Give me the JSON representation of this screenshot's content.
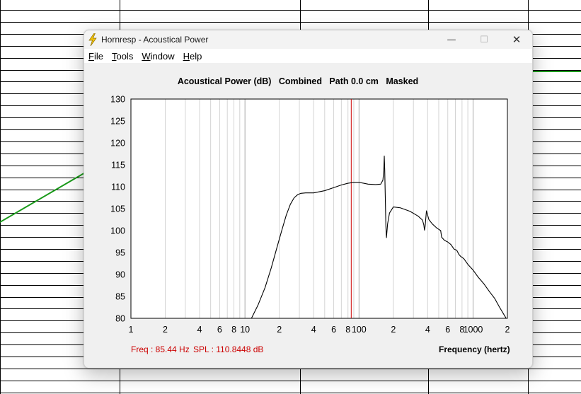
{
  "window": {
    "title": "Hornresp - Acoustical Power",
    "controls": {
      "minimize": "—",
      "maximize": "☐",
      "close": "✕"
    }
  },
  "menu": [
    {
      "key": "F",
      "rest": "ile"
    },
    {
      "key": "T",
      "rest": "ools"
    },
    {
      "key": "W",
      "rest": "indow"
    },
    {
      "key": "H",
      "rest": "elp"
    }
  ],
  "status": {
    "freq": "Freq : 85.44 Hz",
    "spl": "SPL : 110.8448 dB"
  },
  "colors": {
    "curve": "#000000",
    "cursor": "#cc0000",
    "grid": "#d4d4d4",
    "background_trace": "#1a9a1a"
  },
  "chart_data": {
    "type": "line",
    "title": "Acoustical Power (dB)   Combined   Path 0.0 cm   Masked",
    "xlabel": "Frequency (hertz)",
    "ylabel": "",
    "xscale": "log",
    "xlim": [
      1,
      2000
    ],
    "ylim": [
      80,
      130
    ],
    "yticks": [
      80,
      85,
      90,
      95,
      100,
      105,
      110,
      115,
      120,
      125,
      130
    ],
    "xtick_labels": [
      {
        "value": 1,
        "label": "1"
      },
      {
        "value": 2,
        "label": "2"
      },
      {
        "value": 4,
        "label": "4"
      },
      {
        "value": 6,
        "label": "6"
      },
      {
        "value": 8,
        "label": "8"
      },
      {
        "value": 10,
        "label": "10"
      },
      {
        "value": 20,
        "label": "2"
      },
      {
        "value": 40,
        "label": "4"
      },
      {
        "value": 60,
        "label": "6"
      },
      {
        "value": 80,
        "label": "8"
      },
      {
        "value": 100,
        "label": "100"
      },
      {
        "value": 200,
        "label": "2"
      },
      {
        "value": 400,
        "label": "4"
      },
      {
        "value": 600,
        "label": "6"
      },
      {
        "value": 800,
        "label": "8"
      },
      {
        "value": 1000,
        "label": "1000"
      },
      {
        "value": 2000,
        "label": "2"
      }
    ],
    "cursor_x": 85.44,
    "series": [
      {
        "x": [
          11.4,
          13,
          15,
          17,
          19,
          21,
          23,
          25,
          27,
          29,
          31,
          34,
          40,
          50,
          60,
          70,
          80,
          90,
          100,
          110,
          120,
          140,
          155,
          162,
          165,
          166.5,
          168,
          170,
          172,
          174,
          178,
          185,
          200,
          230,
          280,
          330,
          360,
          370,
          375,
          380,
          390,
          410,
          440,
          480,
          520,
          530,
          560,
          600,
          640,
          680,
          720,
          750,
          780,
          830,
          900,
          1000,
          1100,
          1250,
          1400,
          1550,
          1700,
          1850,
          1950
        ],
        "y": [
          80,
          83,
          87,
          91.5,
          96,
          100,
          103.5,
          106,
          107.5,
          108.2,
          108.5,
          108.6,
          108.6,
          109.1,
          109.8,
          110.4,
          110.8,
          111,
          111,
          110.8,
          110.6,
          110.5,
          110.6,
          111.5,
          113.8,
          117,
          114,
          107.5,
          101,
          98.4,
          101.5,
          104,
          105.4,
          105.2,
          104.4,
          103.3,
          102.4,
          101.3,
          100.1,
          101,
          104.5,
          102.5,
          101.5,
          100.6,
          100,
          98.5,
          97.8,
          97.4,
          96.8,
          95.8,
          95.5,
          94.6,
          94.1,
          93.6,
          92.3,
          91,
          89.5,
          87.8,
          86,
          84.5,
          82.6,
          81,
          80
        ]
      }
    ]
  }
}
